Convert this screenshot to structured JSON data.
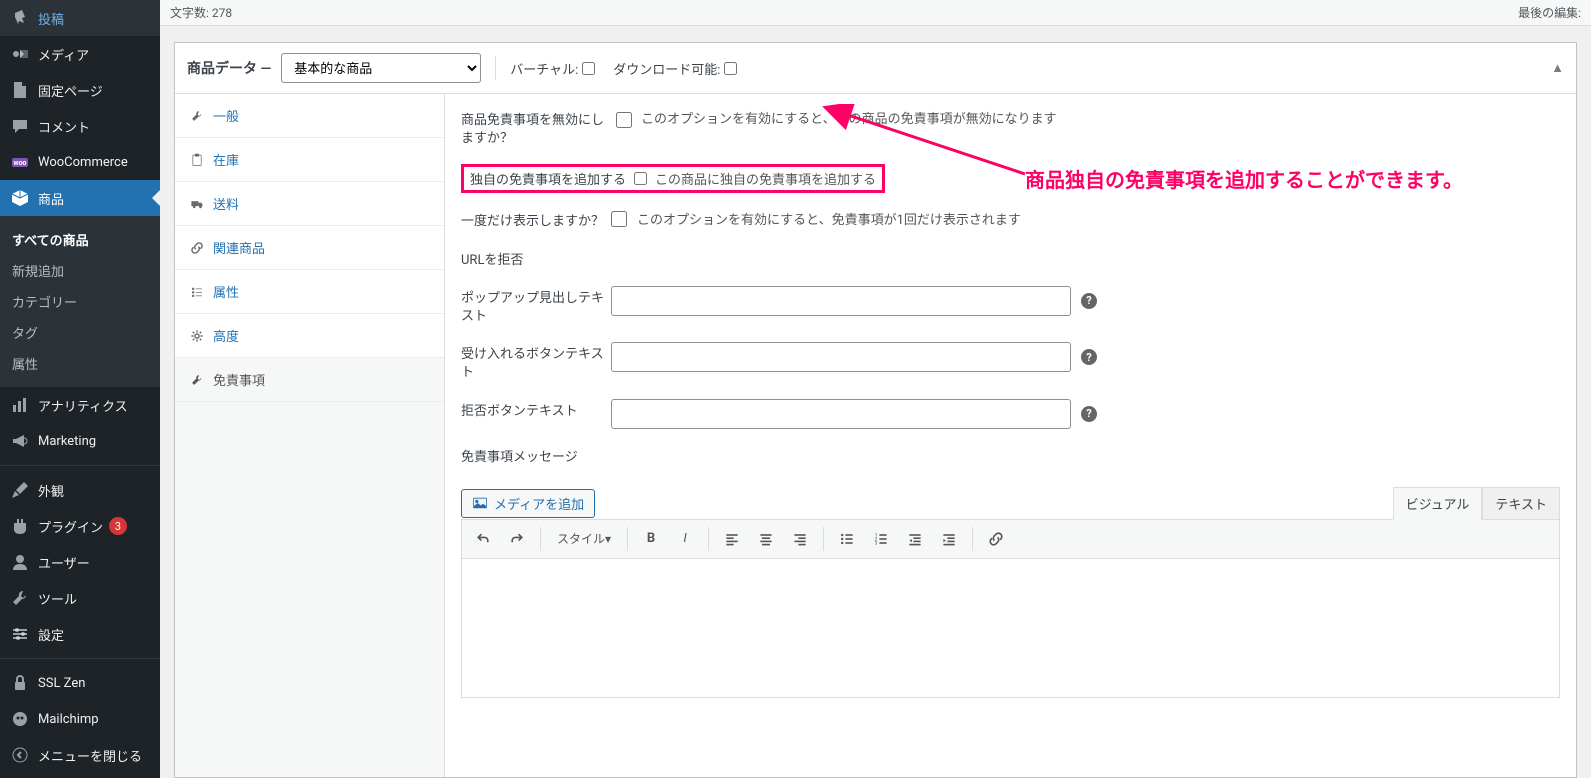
{
  "sidebar": {
    "items": [
      {
        "icon": "pin",
        "label": "投稿"
      },
      {
        "icon": "media",
        "label": "メディア"
      },
      {
        "icon": "page",
        "label": "固定ページ"
      },
      {
        "icon": "comment",
        "label": "コメント"
      },
      {
        "icon": "woo",
        "label": "WooCommerce"
      },
      {
        "icon": "product",
        "label": "商品"
      },
      {
        "icon": "analytics",
        "label": "アナリティクス"
      },
      {
        "icon": "marketing",
        "label": "Marketing"
      },
      {
        "icon": "appearance",
        "label": "外観"
      },
      {
        "icon": "plugin",
        "label": "プラグイン"
      },
      {
        "icon": "users",
        "label": "ユーザー"
      },
      {
        "icon": "tools",
        "label": "ツール"
      },
      {
        "icon": "settings",
        "label": "設定"
      },
      {
        "icon": "ssl",
        "label": "SSL Zen"
      },
      {
        "icon": "mailchimp",
        "label": "Mailchimp"
      },
      {
        "icon": "collapse",
        "label": "メニューを閉じる"
      }
    ],
    "submenu": [
      {
        "label": "すべての商品",
        "current": true
      },
      {
        "label": "新規追加"
      },
      {
        "label": "カテゴリー"
      },
      {
        "label": "タグ"
      },
      {
        "label": "属性"
      }
    ],
    "plugin_badge": "3"
  },
  "topbar": {
    "char_count_label": "文字数:",
    "char_count_value": "278",
    "last_edit_label": "最後の編集:"
  },
  "panel": {
    "title": "商品データ —",
    "product_type": "基本的な商品",
    "virtual_label": "バーチャル:",
    "downloadable_label": "ダウンロード可能:"
  },
  "ptabs": [
    {
      "key": "general",
      "label": "一般"
    },
    {
      "key": "inventory",
      "label": "在庫"
    },
    {
      "key": "shipping",
      "label": "送料"
    },
    {
      "key": "linked",
      "label": "関連商品"
    },
    {
      "key": "attributes",
      "label": "属性"
    },
    {
      "key": "advanced",
      "label": "高度"
    },
    {
      "key": "disclaimer",
      "label": "免責事項"
    }
  ],
  "fields": {
    "disable": {
      "label": "商品免責事項を無効にしますか？",
      "desc": "このオプションを有効にすると、この商品の免責事項が無効になります"
    },
    "add_own": {
      "label": "独自の免責事項を追加する",
      "desc": "この商品に独自の免責事項を追加する"
    },
    "once": {
      "label": "一度だけ表示しますか？",
      "desc": "このオプションを有効にすると、免責事項が1回だけ表示されます"
    },
    "reject_url": {
      "label": "URLを拒否"
    },
    "heading": {
      "label": "ポップアップ見出しテキスト"
    },
    "accept": {
      "label": "受け入れるボタンテキスト"
    },
    "reject": {
      "label": "拒否ボタンテキスト"
    },
    "message": {
      "label": "免責事項メッセージ"
    }
  },
  "annotation": "商品独自の免責事項を追加することができます。",
  "editor": {
    "add_media": "メディアを追加",
    "visual_tab": "ビジュアル",
    "text_tab": "テキスト",
    "style_label": "スタイル"
  }
}
